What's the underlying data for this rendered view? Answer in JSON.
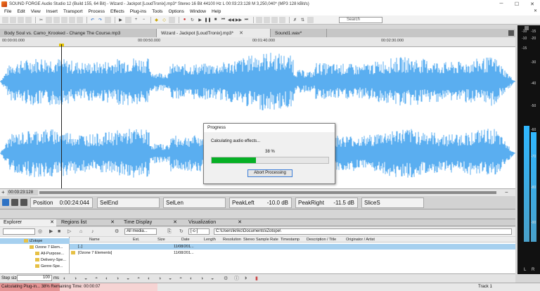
{
  "window": {
    "title": "SOUND FORGE Audio Studio 12 (Build 155, 64 Bit)  -  Wizard - Jackpot [LoudTronix].mp3* Stereo 16 Bit 44100 Hz L 00:03:23:128 M 3,250,040* (MP3 128 kBit/s)",
    "minimize": "─",
    "maximize": "☐",
    "close": "✕"
  },
  "menu": {
    "items": [
      "File",
      "Edit",
      "View",
      "Insert",
      "Transport",
      "Process",
      "Effects",
      "Plug-ins",
      "Tools",
      "Options",
      "Window",
      "Help"
    ],
    "close": "✕"
  },
  "toolbar": {
    "search_placeholder": "Search"
  },
  "doc_tabs": [
    {
      "label": "Body  Soul vs. Camo_Krooked - Change The Course.mp3",
      "close": ""
    },
    {
      "label": "Wizard - Jackpot [LoudTronix].mp3*",
      "close": "✕"
    },
    {
      "label": "Sound1.wav*",
      "close": ""
    }
  ],
  "ruler": {
    "labels": [
      "00:00:00.000",
      "00:00:50.000",
      "00:01:40.000",
      "00:02:30.000"
    ]
  },
  "progress_dialog": {
    "title": "Progress",
    "message": "Calculating audio effects...",
    "percent_text": "38 %",
    "fraction": 0.38,
    "button": "Abort Processing"
  },
  "scroll": {
    "position": "00:03:23:128",
    "zoom_minus": "+",
    "zoom_plus": "−"
  },
  "fields": {
    "position_label": "Position",
    "position_value": "0:00:24:044",
    "selend_label": "SelEnd",
    "sellen_label": "SelLen",
    "peakleft_label": "PeakLeft",
    "peakleft_value": "-10.0 dB",
    "peakright_label": "PeakRight",
    "peakright_value": "-11.5 dB",
    "slices_label": "SliceS"
  },
  "dock_tabs": [
    "Explorer",
    "Regions list",
    "Time Display",
    "Visualization"
  ],
  "explorer": {
    "filter": "All media...",
    "drive": "[-c-]",
    "path": "C:\\Users\\krikc\\Documents\\iZotope\\",
    "tree": [
      "iZotope",
      "Ozone 7 Elem...",
      "All-Purpose...",
      "Delivery-Spe...",
      "Genre-Spe..."
    ],
    "columns": [
      "Name",
      "Ext.",
      "Size",
      "Date",
      "Length",
      "Resolution",
      "Stereo",
      "Sample Rate",
      "Timestamp",
      "Description / Title",
      "Originator / Artist"
    ],
    "rows": [
      {
        "name": "[..]",
        "ext": "",
        "size": "",
        "date": "11/08/201..."
      },
      {
        "name": "[Ozone 7 Elements]",
        "ext": "",
        "size": "",
        "date": "11/08/201..."
      }
    ]
  },
  "bottom": {
    "step_label": "Step size",
    "step_value": "100",
    "step_unit": "ms"
  },
  "status": {
    "text": "Calculating Plug-in...  38%   Remaining Time: 00:00:07",
    "fraction": 0.38,
    "right": "Track 1"
  },
  "meters": {
    "scale": [
      "-10",
      "-15",
      "-10",
      "-20",
      "-15",
      "-30",
      "-40",
      "-50",
      "-60",
      "-70",
      "-80",
      "-90"
    ],
    "left_label": "L",
    "right_label": "R",
    "left_level": 0.55,
    "right_level": 0.52,
    "colors": {
      "top": "#2fb7ff",
      "mid": "#49a0c9"
    }
  },
  "colors": {
    "wave": "#5aaef0",
    "wave_dark": "#2d7fc6",
    "progress_fill": "#06b025"
  }
}
